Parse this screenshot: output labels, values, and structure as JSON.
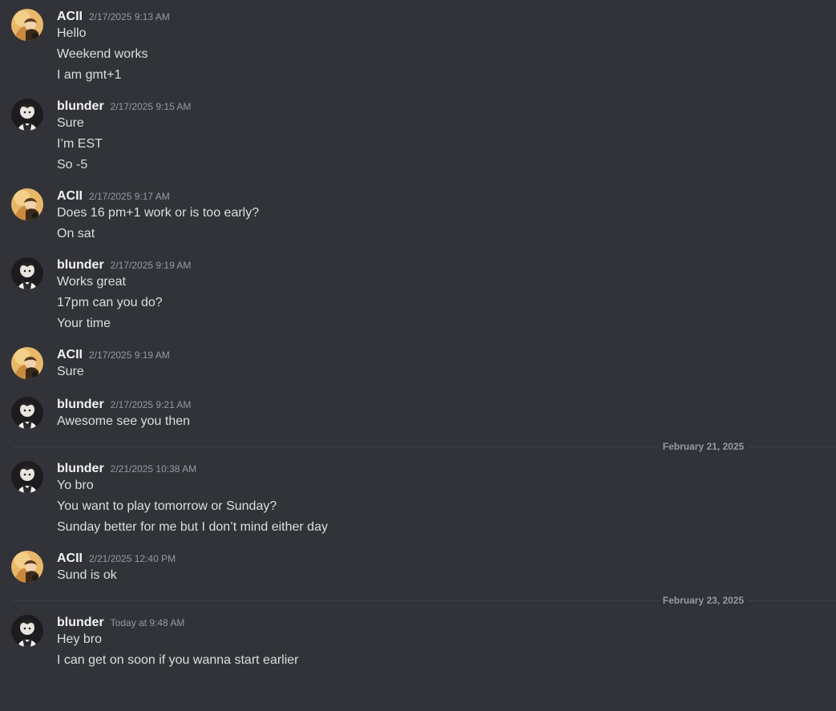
{
  "messages": [
    {
      "author": "ACII",
      "timestamp": "2/17/2025 9:13 AM",
      "lines": [
        "Hello",
        "Weekend works",
        "I am gmt+1"
      ]
    },
    {
      "author": "blunder",
      "timestamp": "2/17/2025 9:15 AM",
      "lines": [
        "Sure",
        "I’m EST",
        "So -5"
      ]
    },
    {
      "author": "ACII",
      "timestamp": "2/17/2025 9:17 AM",
      "lines": [
        "Does 16 pm+1 work or is too early?",
        "On sat"
      ]
    },
    {
      "author": "blunder",
      "timestamp": "2/17/2025 9:19 AM",
      "lines": [
        "Works great",
        "17pm can you do?",
        "Your time"
      ]
    },
    {
      "author": "ACII",
      "timestamp": "2/17/2025 9:19 AM",
      "lines": [
        "Sure"
      ]
    },
    {
      "author": "blunder",
      "timestamp": "2/17/2025 9:21 AM",
      "lines": [
        "Awesome see you then"
      ]
    },
    {
      "divider": "February 21, 2025"
    },
    {
      "author": "blunder",
      "timestamp": "2/21/2025 10:38 AM",
      "lines": [
        "Yo bro",
        "You want to play tomorrow or Sunday?",
        "Sunday better for me but I don’t mind either day"
      ]
    },
    {
      "author": "ACII",
      "timestamp": "2/21/2025 12:40 PM",
      "lines": [
        "Sund is ok"
      ]
    },
    {
      "divider": "February 23, 2025"
    },
    {
      "author": "blunder",
      "timestamp": "Today at 9:48 AM",
      "lines": [
        "Hey bro",
        "I can get on soon if you wanna start earlier"
      ]
    }
  ],
  "colors": {
    "background": "#313338",
    "text": "#dbdee1",
    "username": "#f2f3f5",
    "muted": "#949ba4",
    "divider": "#3f4147"
  },
  "icons": {
    "ACII": "avatar-painting-icon",
    "blunder": "avatar-anime-character-icon"
  }
}
